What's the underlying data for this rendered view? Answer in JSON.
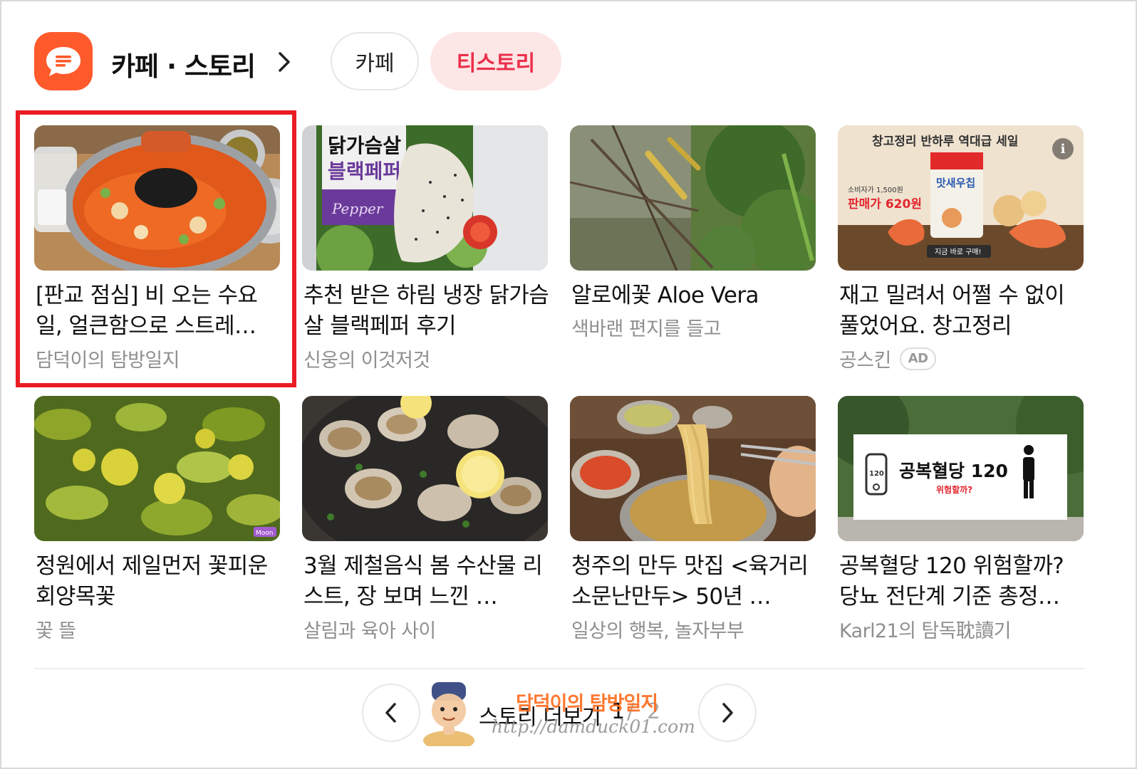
{
  "header": {
    "icon": "chat-bubble-icon",
    "title": "카페 · 스토리",
    "tabs": [
      {
        "label": "카페",
        "selected": false
      },
      {
        "label": "티스토리",
        "selected": true
      }
    ],
    "accent_color": "#ff5a2c",
    "tab_selected_text_color": "#eb2f4a",
    "tab_selected_bg": "#fde6e6"
  },
  "cards": [
    {
      "title": "[판교 점심] 비 오는 수요일, 얼큰함으로 스트레…",
      "source": "담덕이의 탐방일지",
      "highlighted": true
    },
    {
      "title": "추천 받은 하림 냉장 닭가슴살 블랙페퍼 후기",
      "source": "신웅의 이것저것"
    },
    {
      "title": "알로에꽃 Aloe Vera",
      "source": "색바랜 편지를 들고"
    },
    {
      "title": "재고 밀려서 어쩔 수 없이 풀었어요. 창고정리",
      "source": "공스킨",
      "badge": "AD",
      "thumb_text": {
        "banner": "창고정리 반하루 역대급 세일",
        "price_label": "판매가 620원",
        "orig_label": "소비자가 1,500원",
        "brand": "맛새우칩",
        "cta": "지금 바로 구매!"
      }
    },
    {
      "title": "정원에서 제일먼저 꽃피운 회양목꽃",
      "source": "꽃 뜰"
    },
    {
      "title": "3월 제철음식 봄 수산물 리스트, 장 보며 느낀 …",
      "source": "살림과 육아 사이"
    },
    {
      "title": "청주의 만두 맛집 <육거리소문난만두> 50년 …",
      "source": "일상의 행복, 놀자부부"
    },
    {
      "title": "공복혈당 120 위험할까? 당뇨 전단계 기준 총정…",
      "source": "Karl21의 탐독耽讀기",
      "thumb_text": {
        "headline": "공복혈당 120",
        "sub": "위험할까?",
        "meter": "120"
      }
    }
  ],
  "card2_thumb_text": {
    "line1": "닭가슴살",
    "line2": "블랙페퍼",
    "script": "Pepper"
  },
  "card5_thumb_text": "Moon",
  "pager": {
    "label": "스토리 더보기",
    "current": "1",
    "separator": "/",
    "total": "2",
    "prev_icon": "chevron-left-icon",
    "next_icon": "chevron-right-icon"
  },
  "watermark": {
    "name": "담덕이의 탐방일지",
    "url": "http://damduck01.com"
  }
}
